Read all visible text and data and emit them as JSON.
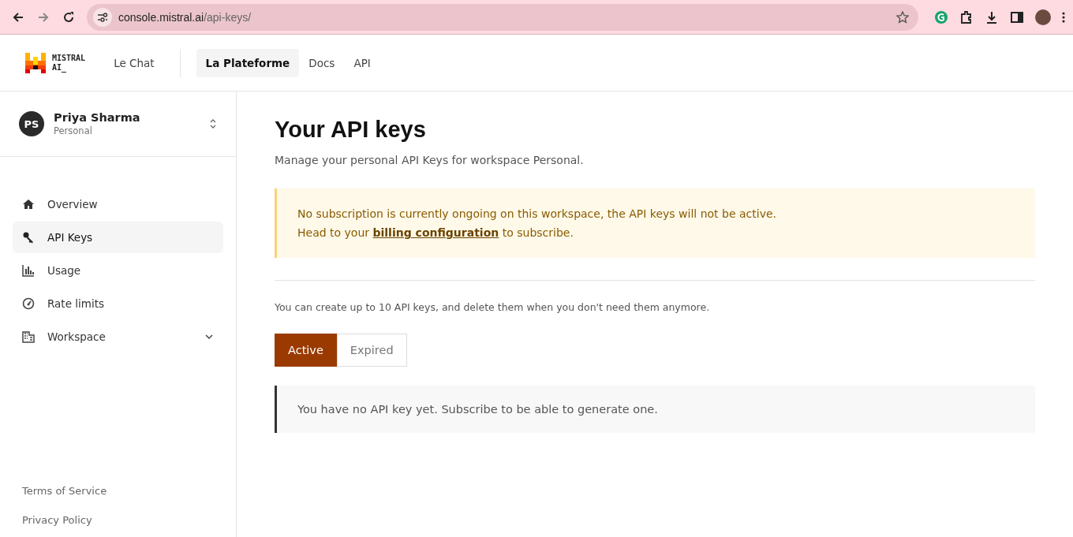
{
  "browser": {
    "url_host": "console.mistral.ai",
    "url_path": "/api-keys/"
  },
  "header": {
    "logo_lines": [
      "MISTRAL",
      "AI_"
    ],
    "nav": [
      {
        "label": "Le Chat",
        "selected": false
      },
      {
        "label": "La Plateforme",
        "selected": true
      },
      {
        "label": "Docs",
        "selected": false
      },
      {
        "label": "API",
        "selected": false
      }
    ]
  },
  "sidebar": {
    "user": {
      "initials": "PS",
      "name": "Priya Sharma",
      "workspace": "Personal"
    },
    "items": [
      {
        "kind": "home",
        "label": "Overview",
        "selected": false
      },
      {
        "kind": "key",
        "label": "API Keys",
        "selected": true
      },
      {
        "kind": "chart",
        "label": "Usage",
        "selected": false
      },
      {
        "kind": "gauge",
        "label": "Rate limits",
        "selected": false
      },
      {
        "kind": "building",
        "label": "Workspace",
        "selected": false,
        "expanded": false
      }
    ],
    "footer_links": [
      "Terms of Service",
      "Privacy Policy"
    ]
  },
  "main": {
    "title": "Your API keys",
    "subtitle": "Manage your personal API Keys for workspace Personal.",
    "warning": {
      "line1": "No subscription is currently ongoing on this workspace, the API keys will not be active.",
      "line2_before": "Head to your",
      "link": "billing configuration",
      "line2_after": "to subscribe."
    },
    "info": "You can create up to 10 API keys, and delete them when you don't need them anymore.",
    "tabs": [
      {
        "label": "Active",
        "selected": true
      },
      {
        "label": "Expired",
        "selected": false
      }
    ],
    "empty_message": "You have no API key yet. Subscribe to be able to generate one."
  }
}
